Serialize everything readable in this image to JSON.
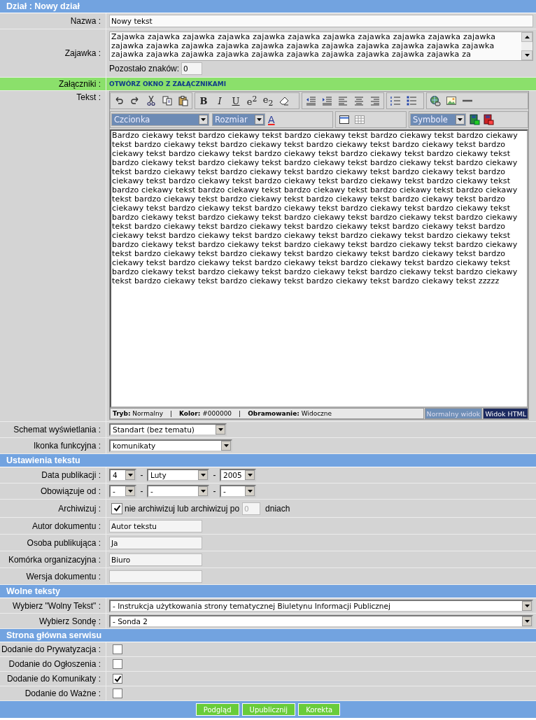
{
  "title": "Dział : Nowy dział",
  "name_field": {
    "label": "Nazwa :",
    "value": "Nowy tekst"
  },
  "lead_field": {
    "label": "Zajawka :",
    "value": "Zajawka zajawka zajawka zajawka zajawka zajawka zajawka zajawka zajawka zajawka zajawka zajawka zajawka zajawka zajawka zajawka zajawka zajawka zajawka zajawka zajawka zajawka zajawka zajawka zajawka zajawka zajawka zajawka zajawka zajawka zajawka zajawka za",
    "remaining_label": "Pozostało znaków:",
    "remaining_value": "0"
  },
  "attachments": {
    "label": "Załączniki :",
    "link": "OTWÓRZ OKNO Z ZAŁĄCZNIKAMI"
  },
  "editor": {
    "label": "Tekst :",
    "format_buttons": [
      {
        "label": "B"
      },
      {
        "label": "I"
      },
      {
        "label": "U"
      },
      {
        "label": "e$^{2}$"
      },
      {
        "label": "e$_{2}$"
      }
    ],
    "font_select": "Czcionka",
    "size_select": "Rozmiar",
    "font_color": "A",
    "symbol_select": "Symbole",
    "content": "Bardzo ciekawy tekst bardzo ciekawy tekst bardzo ciekawy tekst bardzo ciekawy tekst bardzo ciekawy tekst bardzo ciekawy tekst bardzo ciekawy tekst bardzo ciekawy tekst bardzo ciekawy tekst bardzo ciekawy tekst bardzo ciekawy tekst bardzo ciekawy tekst bardzo ciekawy tekst bardzo ciekawy tekst bardzo ciekawy tekst bardzo ciekawy tekst bardzo ciekawy tekst bardzo ciekawy tekst bardzo ciekawy tekst bardzo ciekawy tekst bardzo ciekawy tekst bardzo ciekawy tekst bardzo ciekawy tekst bardzo ciekawy tekst bardzo ciekawy tekst bardzo ciekawy tekst bardzo ciekawy tekst bardzo ciekawy tekst bardzo ciekawy tekst bardzo ciekawy tekst bardzo ciekawy tekst bardzo ciekawy tekst bardzo ciekawy tekst bardzo ciekawy tekst bardzo ciekawy tekst bardzo ciekawy tekst bardzo ciekawy tekst bardzo ciekawy tekst bardzo ciekawy tekst bardzo ciekawy tekst bardzo ciekawy tekst bardzo ciekawy tekst bardzo ciekawy tekst bardzo ciekawy tekst bardzo ciekawy tekst bardzo ciekawy tekst bardzo ciekawy tekst bardzo ciekawy tekst bardzo ciekawy tekst bardzo ciekawy tekst bardzo ciekawy tekst bardzo ciekawy tekst bardzo ciekawy tekst bardzo ciekawy tekst bardzo ciekawy tekst bardzo ciekawy tekst bardzo ciekawy tekst bardzo ciekawy tekst bardzo ciekawy tekst bardzo ciekawy tekst bardzo ciekawy tekst bardzo ciekawy tekst bardzo ciekawy tekst bardzo ciekawy tekst bardzo ciekawy tekst bardzo ciekawy tekst bardzo ciekawy tekst bardzo ciekawy tekst bardzo ciekawy tekst bardzo ciekawy tekst bardzo ciekawy tekst bardzo ciekawy tekst bardzo ciekawy tekst bardzo ciekawy tekst bardzo ciekawy tekst bardzo ciekawy tekst bardzo ciekawy tekst bardzo ciekawy tekst bardzo ciekawy tekst zzzzz",
    "status": [
      "**Tryb:** Normalny",
      "|",
      "**Kolor:** #000000",
      "|",
      "**Obramowanie:** Widoczne"
    ],
    "view_tabs": [
      {
        "label": "Normalny widok",
        "selected": true
      },
      {
        "label": "Widok HTML",
        "selected": false
      }
    ]
  },
  "display_selects": [
    {
      "label": "Schemat wyświetlania :",
      "value": "Standart (bez tematu)"
    },
    {
      "label": "Ikonka funkcyjna :",
      "value": "komunikaty"
    }
  ],
  "text_settings": {
    "title": "Ustawienia tekstu",
    "dates": [
      {
        "label": "Data publikacji :",
        "day": "4",
        "month": "Luty",
        "year": "2005",
        "separators": [
          "-",
          "-"
        ]
      },
      {
        "label": "Obowiązuje od :",
        "day": "-",
        "month": "-",
        "year": "-",
        "separators": [
          "-",
          "-"
        ]
      }
    ],
    "archive": {
      "label": "Archiwizuj :",
      "checked": true,
      "text": "nie archiwizuj lub archiwizuj po",
      "days": "0",
      "unit": "dniach"
    },
    "text_fields": [
      {
        "label": "Autor dokumentu :",
        "value": "Autor tekstu"
      },
      {
        "label": "Osoba publikująca :",
        "value": "Ja"
      },
      {
        "label": "Komórka organizacyjna :",
        "value": "Biuro"
      },
      {
        "label": "Wersja dokumentu :"
      }
    ]
  },
  "free_texts": {
    "title": "Wolne teksty",
    "selects": [
      {
        "label": "Wybierz \"Wolny Tekst\" :",
        "value": "- Instrukcja użytkowania strony tematycznej Biuletynu Informacji Publicznej"
      },
      {
        "label": "Wybierz Sondę :",
        "value": "- Sonda 2"
      }
    ]
  },
  "home_page": {
    "title": "Strona główna serwisu",
    "checkboxes": [
      {
        "label": "Dodanie do Prywatyzacja :",
        "checked": false
      },
      {
        "label": "Dodanie do Ogłoszenia :",
        "checked": false
      },
      {
        "label": "Dodanie do Komunikaty :",
        "checked": true
      },
      {
        "label": "Dodanie do Ważne :",
        "checked": false
      }
    ]
  },
  "buttons": [
    "Podgląd",
    "Upublicznij",
    "Korekta"
  ]
}
